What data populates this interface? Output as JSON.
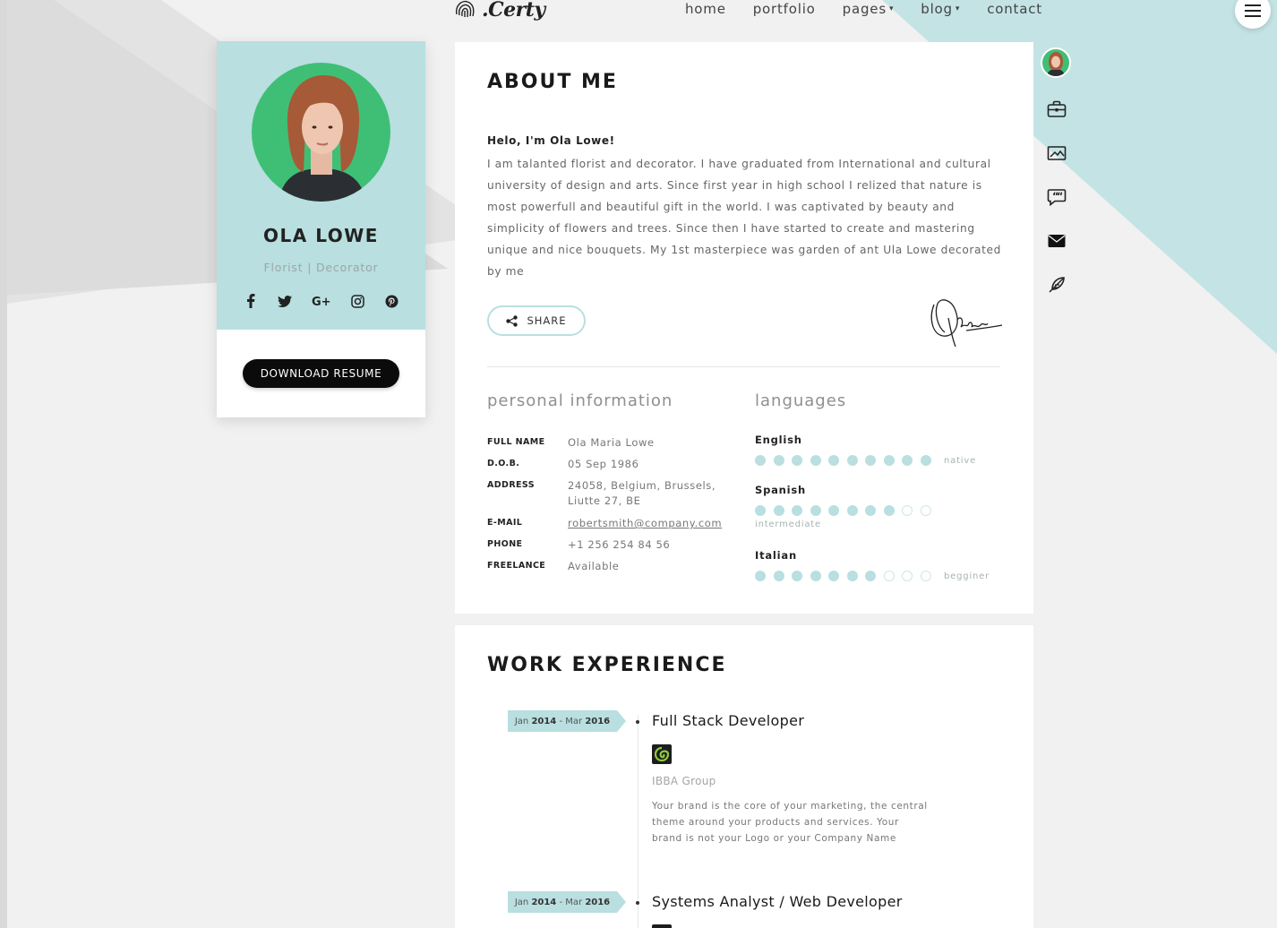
{
  "brand": {
    "logo_text": ".Certy"
  },
  "nav": {
    "items": [
      {
        "label": "home",
        "has_caret": false
      },
      {
        "label": "portfolio",
        "has_caret": false
      },
      {
        "label": "pages",
        "has_caret": true
      },
      {
        "label": "blog",
        "has_caret": true
      },
      {
        "label": "contact",
        "has_caret": false
      }
    ],
    "caret": "▾",
    "menu_icon": "hamburger-icon"
  },
  "profile": {
    "name": "OLA LOWE",
    "role": "Florist | Decorator",
    "social": [
      {
        "icon": "facebook-icon",
        "glyph": "f"
      },
      {
        "icon": "twitter-icon",
        "glyph": "t"
      },
      {
        "icon": "google-plus-icon",
        "glyph": "G+"
      },
      {
        "icon": "instagram-icon",
        "glyph": "ig"
      },
      {
        "icon": "pinterest-icon",
        "glyph": "p"
      }
    ],
    "download_label": "DOWNLOAD RESUME"
  },
  "about": {
    "title": "ABOUT ME",
    "greeting": "Helo, I'm Ola Lowe!",
    "text": "I am talanted florist and decorator. I have graduated from International and cultural university of design and arts. Since first year in high school I relized that nature is most powerfull and beautiful gift in the world. I was captivated by beauty and simplicity of flowers and trees. Since then I have started to create and mastering unique and nice bouquets. My 1st masterpiece was garden of ant Ula Lowe decorated by me",
    "share_label": "SHARE",
    "personal_title": "personal information",
    "languages_title": "languages",
    "personal_info": [
      {
        "label": "FULL NAME",
        "value": "Ola Maria Lowe"
      },
      {
        "label": "D.O.B.",
        "value": "05 Sep 1986"
      },
      {
        "label": "ADDRESS",
        "value": "24058, Belgium, Brussels, Liutte 27, BE"
      },
      {
        "label": "E-MAIL",
        "value": "robertsmith@company.com"
      },
      {
        "label": "PHONE",
        "value": "+1 256 254 84 56"
      },
      {
        "label": "FREELANCE",
        "value": "Available"
      }
    ],
    "languages": [
      {
        "name": "English",
        "level": "native",
        "rating": 10,
        "max": 10
      },
      {
        "name": "Spanish",
        "level": "intermediate",
        "rating": 8,
        "max": 10
      },
      {
        "name": "Italian",
        "level": "begginer",
        "rating": 7,
        "max": 10
      }
    ]
  },
  "work": {
    "title": "WORK EXPERIENCE",
    "jobs": [
      {
        "date_start_month": "Jan",
        "date_start_year": "2014",
        "date_end_month": "Mar",
        "date_end_year": "2016",
        "title": "Full Stack Developer",
        "company": "IBBA Group",
        "description": "Your brand is the core of your marketing, the central theme around your products and services. Your brand is not your Logo or your Company Name"
      },
      {
        "date_start_month": "Jan",
        "date_start_year": "2014",
        "date_end_month": "Mar",
        "date_end_year": "2016",
        "title": "Systems Analyst / Web Developer",
        "company": "",
        "description": ""
      }
    ]
  },
  "side_menu": [
    {
      "icon": "avatar-icon"
    },
    {
      "icon": "briefcase-icon"
    },
    {
      "icon": "portfolio-image-icon"
    },
    {
      "icon": "quote-icon"
    },
    {
      "icon": "envelope-icon"
    },
    {
      "icon": "feather-icon"
    }
  ],
  "colors": {
    "accent": "#b9dfe0",
    "avatar_bg": "#3fbf76",
    "background": "#f1f1f1",
    "card": "#ffffff",
    "button_dark": "#0b0b0b"
  }
}
